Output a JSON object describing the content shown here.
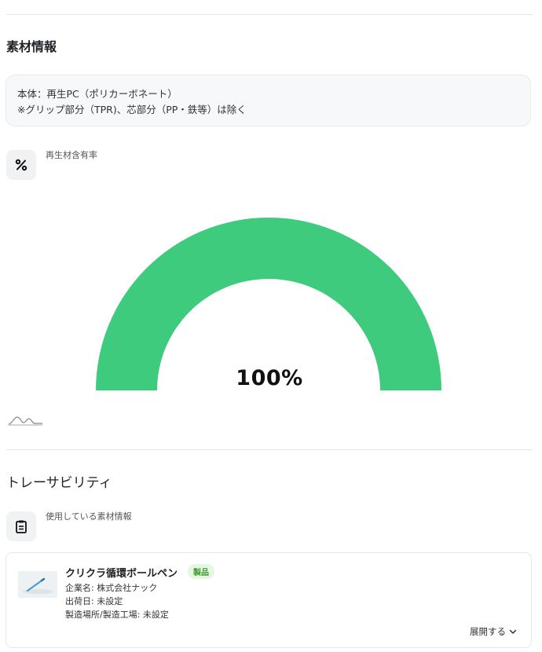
{
  "material_section": {
    "title": "素材情報",
    "body_line1": "本体：再生PC（ポリカーボネート）",
    "body_line2": "※グリップ部分（TPR)、芯部分（PP・鉄等）は除く"
  },
  "recycled": {
    "label": "再生材含有率",
    "icon": "percent-icon",
    "value_text": "100%",
    "fraction": 1.0,
    "gauge_color": "#3ecb7d"
  },
  "traceability": {
    "title": "トレーサビリティ",
    "label": "使用している素材情報",
    "icon": "clipboard-icon"
  },
  "product": {
    "name": "クリクラ循環ボールペン",
    "badge": "製品",
    "company": "企業名: 株式会社ナック",
    "ship_date": "出荷日: 未設定",
    "location": "製造場所/製造工場: 未設定",
    "expand_label": "展開する"
  }
}
